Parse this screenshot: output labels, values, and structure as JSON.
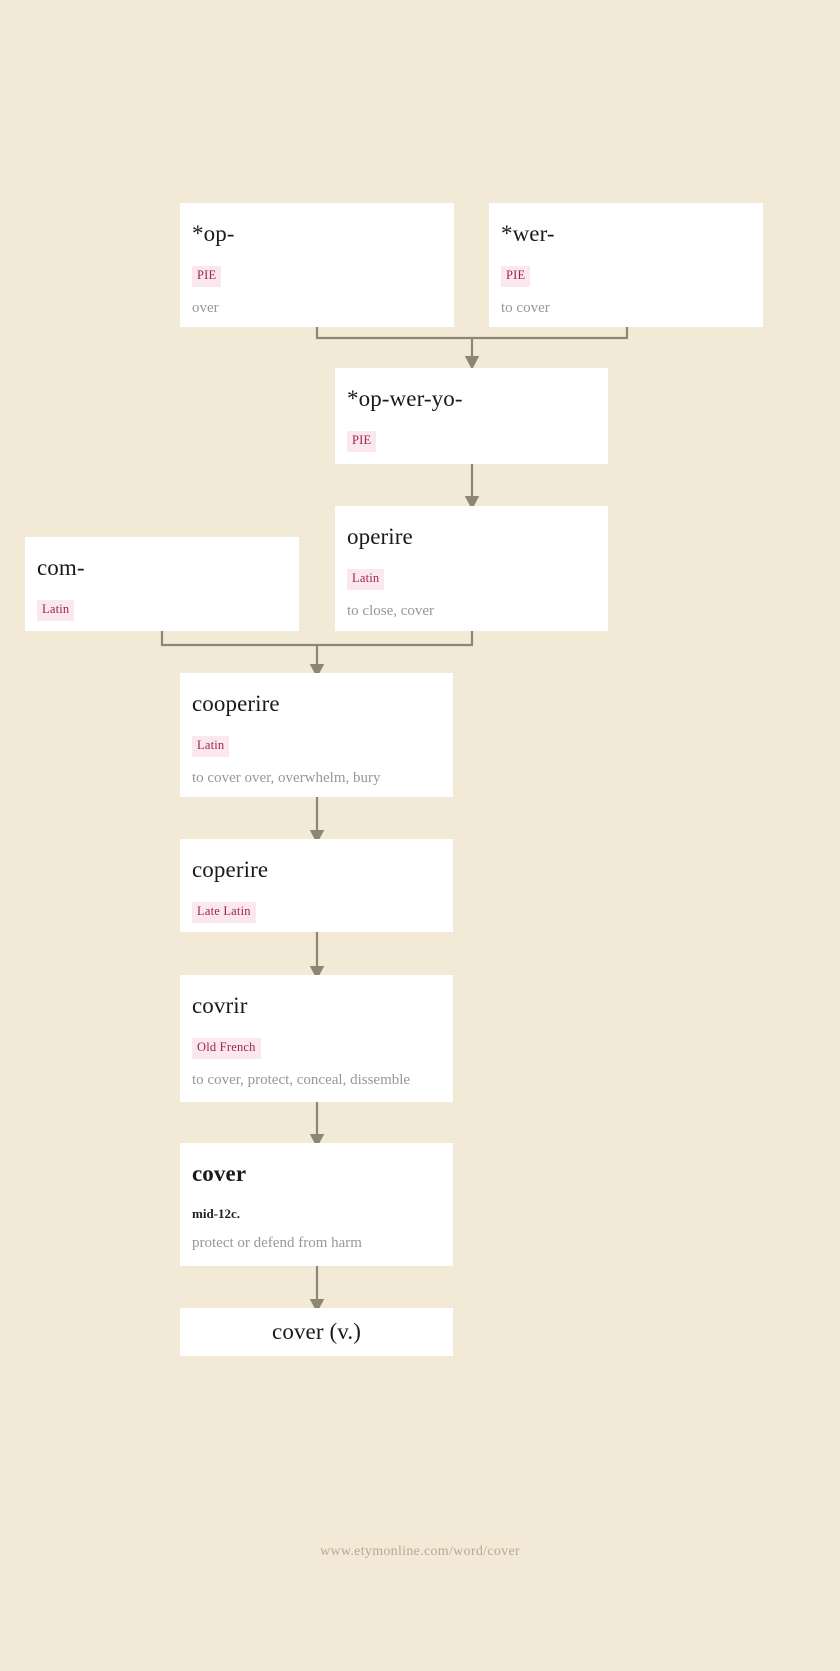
{
  "page": {
    "background_color": "#f2ead7",
    "box_color": "#ffffff",
    "connector_color": "#8d8675",
    "badge_bg": "#fae8ee",
    "badge_fg": "#9e2449",
    "gloss_color": "#9b9792",
    "footer_color": "#b8a98f"
  },
  "footer": {
    "url": "www.etymonline.com/word/cover"
  },
  "nodes": {
    "op": {
      "title": "*op-",
      "lang": "PIE",
      "gloss": "over"
    },
    "wer": {
      "title": "*wer-",
      "lang": "PIE",
      "gloss": "to cover"
    },
    "opweryo": {
      "title": "*op-wer-yo-",
      "lang": "PIE",
      "gloss": ""
    },
    "operire": {
      "title": "operire",
      "lang": "Latin",
      "gloss": "to close, cover"
    },
    "com": {
      "title": "com-",
      "lang": "Latin",
      "gloss": ""
    },
    "cooperire": {
      "title": "cooperire",
      "lang": "Latin",
      "gloss": "to cover over, overwhelm, bury"
    },
    "coperire": {
      "title": "coperire",
      "lang": "Late Latin",
      "gloss": ""
    },
    "covrir": {
      "title": "covrir",
      "lang": "Old French",
      "gloss": "to cover, protect, conceal, dissemble"
    },
    "cover": {
      "title": "cover",
      "date": "mid-12c.",
      "gloss": "protect or defend from harm"
    },
    "cover_v": {
      "title": "cover (v.)"
    }
  }
}
